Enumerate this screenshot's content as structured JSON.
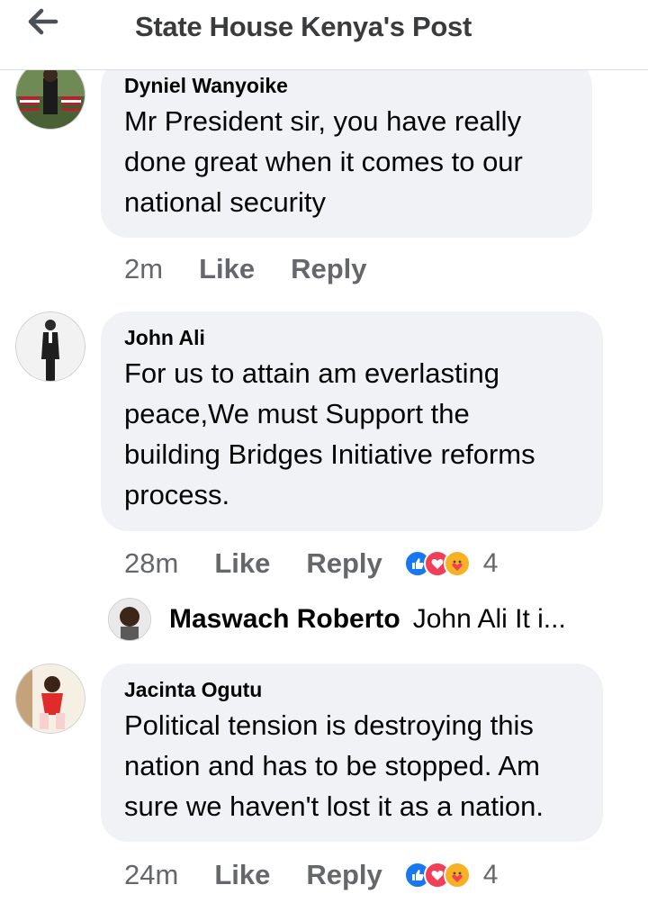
{
  "header": {
    "title": "State House Kenya's Post",
    "back_icon": "back-arrow-icon"
  },
  "comments": [
    {
      "author": "Dyniel Wanyoike",
      "text_lines": [
        "Mr President  sir, you have really",
        "done great when it comes to our",
        "national security"
      ],
      "time": "2m",
      "like_label": "Like",
      "reply_label": "Reply"
    },
    {
      "author": "John Ali",
      "text_lines": [
        "For us to attain am everlasting",
        "peace,We must Support the",
        "building Bridges Initiative reforms",
        "process."
      ],
      "time": "28m",
      "like_label": "Like",
      "reply_label": "Reply",
      "reaction_count": "4",
      "reactions": [
        "like-reaction-icon",
        "love-reaction-icon",
        "care-reaction-icon"
      ],
      "reply": {
        "author": "Maswach Roberto",
        "preview": "John Ali It i..."
      }
    },
    {
      "author": "Jacinta Ogutu",
      "text_lines": [
        "Political tension is destroying this",
        "nation and has to be stopped. Am",
        "sure we haven't lost it as a nation."
      ],
      "time": "24m",
      "like_label": "Like",
      "reply_label": "Reply",
      "reaction_count": "4",
      "reactions": [
        "like-reaction-icon",
        "love-reaction-icon",
        "care-reaction-icon"
      ]
    }
  ],
  "colors": {
    "bubble_bg": "#f0f2f5",
    "meta_text": "#65676b",
    "like_blue": "#1877f2",
    "love_red": "#f33e58",
    "care_yellow": "#f7b125"
  }
}
